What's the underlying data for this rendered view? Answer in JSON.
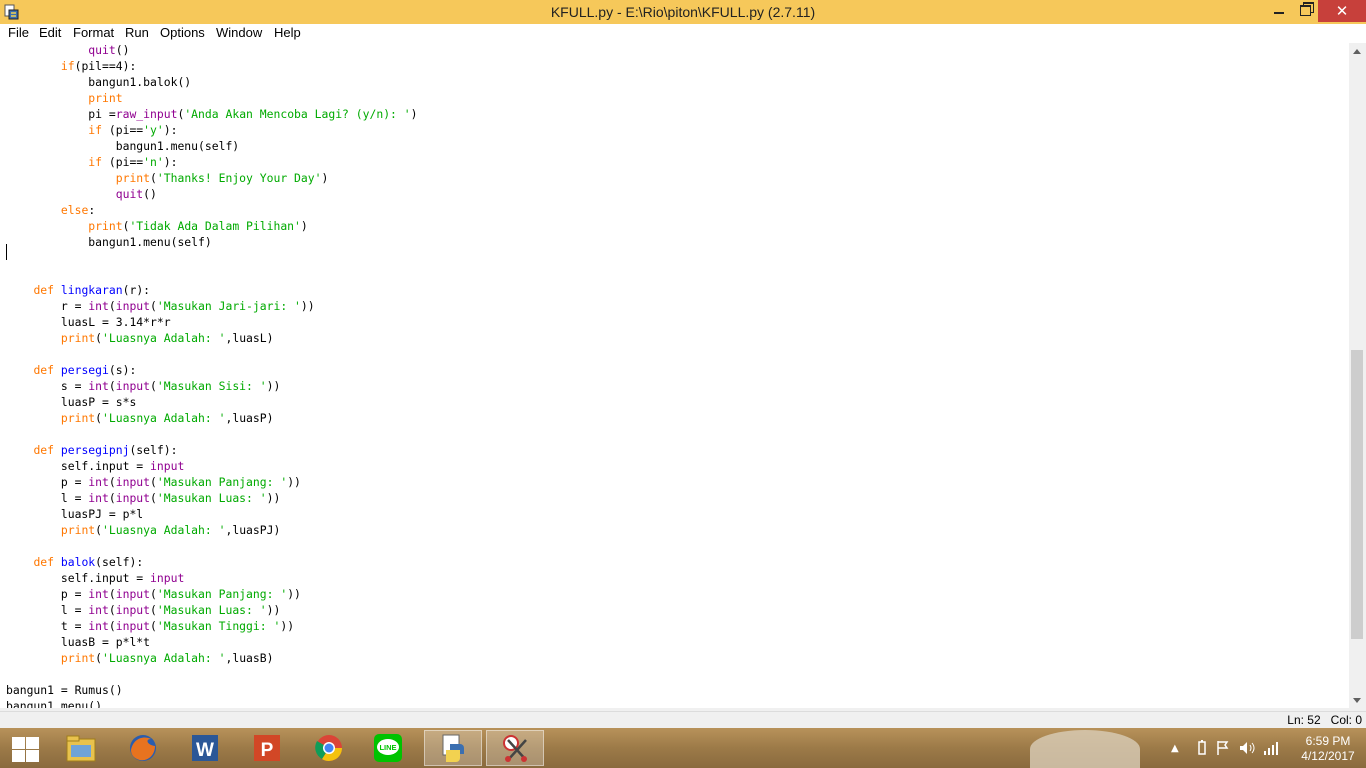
{
  "window": {
    "title": "KFULL.py - E:\\Rio\\piton\\KFULL.py (2.7.11)",
    "minimize_label": "minimize",
    "maximize_label": "restore",
    "close_label": "✕"
  },
  "menu": [
    "File",
    "Edit",
    "Format",
    "Run",
    "Options",
    "Window",
    "Help"
  ],
  "code": [
    [
      {
        "t": "            "
      },
      {
        "t": "quit",
        "c": "bi"
      },
      {
        "t": "()"
      }
    ],
    [
      {
        "t": "        "
      },
      {
        "t": "if",
        "c": "kw"
      },
      {
        "t": "(pil==4):"
      }
    ],
    [
      {
        "t": "            bangun1.balok()"
      }
    ],
    [
      {
        "t": "            "
      },
      {
        "t": "print",
        "c": "kw"
      }
    ],
    [
      {
        "t": "            pi ="
      },
      {
        "t": "raw_input",
        "c": "bi"
      },
      {
        "t": "("
      },
      {
        "t": "'Anda Akan Mencoba Lagi? (y/n): '",
        "c": "str"
      },
      {
        "t": ")"
      }
    ],
    [
      {
        "t": "            "
      },
      {
        "t": "if",
        "c": "kw"
      },
      {
        "t": " (pi=="
      },
      {
        "t": "'y'",
        "c": "str"
      },
      {
        "t": "):"
      }
    ],
    [
      {
        "t": "                bangun1.menu(self)"
      }
    ],
    [
      {
        "t": "            "
      },
      {
        "t": "if",
        "c": "kw"
      },
      {
        "t": " (pi=="
      },
      {
        "t": "'n'",
        "c": "str"
      },
      {
        "t": "):"
      }
    ],
    [
      {
        "t": "                "
      },
      {
        "t": "print",
        "c": "kw"
      },
      {
        "t": "("
      },
      {
        "t": "'Thanks! Enjoy Your Day'",
        "c": "str"
      },
      {
        "t": ")"
      }
    ],
    [
      {
        "t": "                "
      },
      {
        "t": "quit",
        "c": "bi"
      },
      {
        "t": "()"
      }
    ],
    [
      {
        "t": "        "
      },
      {
        "t": "else",
        "c": "kw"
      },
      {
        "t": ":"
      }
    ],
    [
      {
        "t": "            "
      },
      {
        "t": "print",
        "c": "kw"
      },
      {
        "t": "("
      },
      {
        "t": "'Tidak Ada Dalam Pilihan'",
        "c": "str"
      },
      {
        "t": ")"
      }
    ],
    [
      {
        "t": "            bangun1.menu(self)"
      }
    ],
    [],
    [],
    [
      {
        "t": "    "
      },
      {
        "t": "def",
        "c": "kw"
      },
      {
        "t": " "
      },
      {
        "t": "lingkaran",
        "c": "df"
      },
      {
        "t": "(r):"
      }
    ],
    [
      {
        "t": "        r = "
      },
      {
        "t": "int",
        "c": "bi"
      },
      {
        "t": "("
      },
      {
        "t": "input",
        "c": "bi"
      },
      {
        "t": "("
      },
      {
        "t": "'Masukan Jari-jari: '",
        "c": "str"
      },
      {
        "t": "))"
      }
    ],
    [
      {
        "t": "        luasL = 3.14*r*r"
      }
    ],
    [
      {
        "t": "        "
      },
      {
        "t": "print",
        "c": "kw"
      },
      {
        "t": "("
      },
      {
        "t": "'Luasnya Adalah: '",
        "c": "str"
      },
      {
        "t": ",luasL)"
      }
    ],
    [],
    [
      {
        "t": "    "
      },
      {
        "t": "def",
        "c": "kw"
      },
      {
        "t": " "
      },
      {
        "t": "persegi",
        "c": "df"
      },
      {
        "t": "(s):"
      }
    ],
    [
      {
        "t": "        s = "
      },
      {
        "t": "int",
        "c": "bi"
      },
      {
        "t": "("
      },
      {
        "t": "input",
        "c": "bi"
      },
      {
        "t": "("
      },
      {
        "t": "'Masukan Sisi: '",
        "c": "str"
      },
      {
        "t": "))"
      }
    ],
    [
      {
        "t": "        luasP = s*s"
      }
    ],
    [
      {
        "t": "        "
      },
      {
        "t": "print",
        "c": "kw"
      },
      {
        "t": "("
      },
      {
        "t": "'Luasnya Adalah: '",
        "c": "str"
      },
      {
        "t": ",luasP)"
      }
    ],
    [],
    [
      {
        "t": "    "
      },
      {
        "t": "def",
        "c": "kw"
      },
      {
        "t": " "
      },
      {
        "t": "persegipnj",
        "c": "df"
      },
      {
        "t": "(self):"
      }
    ],
    [
      {
        "t": "        self.input = "
      },
      {
        "t": "input",
        "c": "bi"
      }
    ],
    [
      {
        "t": "        p = "
      },
      {
        "t": "int",
        "c": "bi"
      },
      {
        "t": "("
      },
      {
        "t": "input",
        "c": "bi"
      },
      {
        "t": "("
      },
      {
        "t": "'Masukan Panjang: '",
        "c": "str"
      },
      {
        "t": "))"
      }
    ],
    [
      {
        "t": "        l = "
      },
      {
        "t": "int",
        "c": "bi"
      },
      {
        "t": "("
      },
      {
        "t": "input",
        "c": "bi"
      },
      {
        "t": "("
      },
      {
        "t": "'Masukan Luas: '",
        "c": "str"
      },
      {
        "t": "))"
      }
    ],
    [
      {
        "t": "        luasPJ = p*l"
      }
    ],
    [
      {
        "t": "        "
      },
      {
        "t": "print",
        "c": "kw"
      },
      {
        "t": "("
      },
      {
        "t": "'Luasnya Adalah: '",
        "c": "str"
      },
      {
        "t": ",luasPJ)"
      }
    ],
    [],
    [
      {
        "t": "    "
      },
      {
        "t": "def",
        "c": "kw"
      },
      {
        "t": " "
      },
      {
        "t": "balok",
        "c": "df"
      },
      {
        "t": "(self):"
      }
    ],
    [
      {
        "t": "        self.input = "
      },
      {
        "t": "input",
        "c": "bi"
      }
    ],
    [
      {
        "t": "        p = "
      },
      {
        "t": "int",
        "c": "bi"
      },
      {
        "t": "("
      },
      {
        "t": "input",
        "c": "bi"
      },
      {
        "t": "("
      },
      {
        "t": "'Masukan Panjang: '",
        "c": "str"
      },
      {
        "t": "))"
      }
    ],
    [
      {
        "t": "        l = "
      },
      {
        "t": "int",
        "c": "bi"
      },
      {
        "t": "("
      },
      {
        "t": "input",
        "c": "bi"
      },
      {
        "t": "("
      },
      {
        "t": "'Masukan Luas: '",
        "c": "str"
      },
      {
        "t": "))"
      }
    ],
    [
      {
        "t": "        t = "
      },
      {
        "t": "int",
        "c": "bi"
      },
      {
        "t": "("
      },
      {
        "t": "input",
        "c": "bi"
      },
      {
        "t": "("
      },
      {
        "t": "'Masukan Tinggi: '",
        "c": "str"
      },
      {
        "t": "))"
      }
    ],
    [
      {
        "t": "        luasB = p*l*t"
      }
    ],
    [
      {
        "t": "        "
      },
      {
        "t": "print",
        "c": "kw"
      },
      {
        "t": "("
      },
      {
        "t": "'Luasnya Adalah: '",
        "c": "str"
      },
      {
        "t": ",luasB)"
      }
    ],
    [],
    [
      {
        "t": "bangun1 = Rumus()"
      }
    ],
    [
      {
        "t": "bangun1.menu()"
      }
    ]
  ],
  "status": {
    "position": "Ln: 52   Col: 0"
  },
  "taskbar": {
    "apps": [
      "file-explorer-icon",
      "firefox-icon",
      "word-icon",
      "powerpoint-icon",
      "chrome-icon",
      "line-icon",
      "python-idle-icon",
      "snipping-tool-icon"
    ],
    "time": "6:59 PM",
    "date": "4/12/2017"
  },
  "colors": {
    "titlebar": "#f6c85a",
    "keyword": "#ff7700",
    "string": "#00aa00",
    "builtin": "#900090",
    "defname": "#0000ff",
    "close": "#c7403b"
  }
}
